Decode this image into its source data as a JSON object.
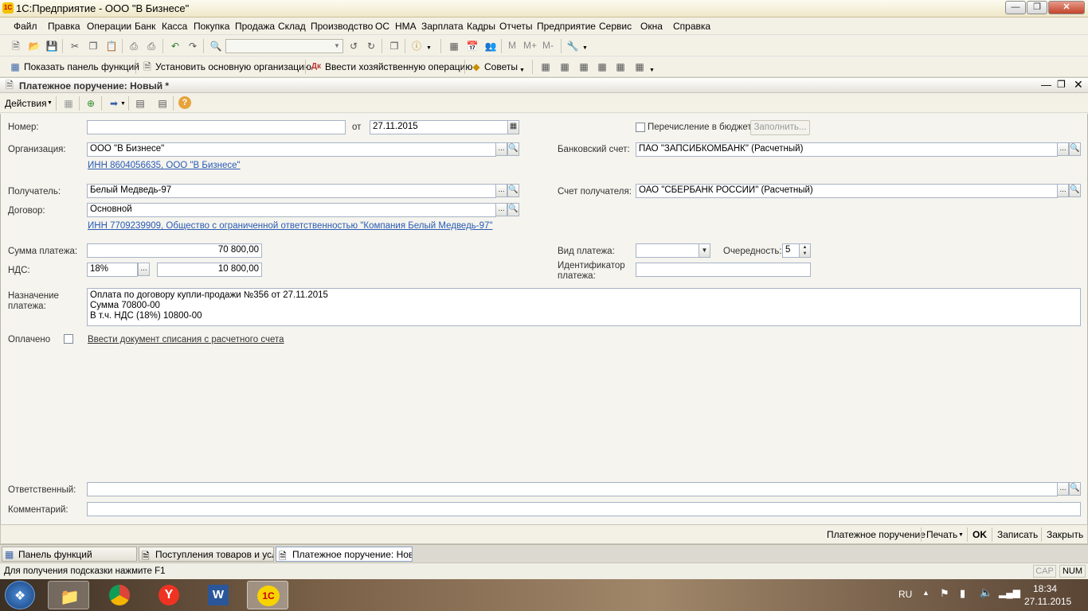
{
  "window": {
    "title": "1С:Предприятие - ООО \"В Бизнесе\""
  },
  "menu": [
    "Файл",
    "Правка",
    "Операции",
    "Банк",
    "Касса",
    "Покупка",
    "Продажа",
    "Склад",
    "Производство",
    "ОС",
    "НМА",
    "Зарплата",
    "Кадры",
    "Отчеты",
    "Предприятие",
    "Сервис",
    "Окна",
    "Справка"
  ],
  "toolbar2": {
    "show_panel": "Показать панель функций",
    "set_org": "Установить основную организацию",
    "enter_op": "Ввести хозяйственную операцию",
    "tips": "Советы",
    "m": "M",
    "m_plus": "M+",
    "m_minus": "M-"
  },
  "doc": {
    "title": "Платежное поручение: Новый *",
    "actions": "Действия",
    "fields": {
      "number_label": "Номер:",
      "number_value": "",
      "from_label": "от",
      "date": "27.11.2015",
      "budget_label": "Перечисление в бюджет",
      "fill_button": "Заполнить...",
      "org_label": "Организация:",
      "org_value": "ООО \"В Бизнесе\"",
      "org_link": "ИНН 8604056635, ООО \"В Бизнесе\"",
      "bank_label": "Банковский счет:",
      "bank_value": "ПАО \"ЗАПСИБКОМБАНК\" (Расчетный)",
      "recipient_label": "Получатель:",
      "recipient_value": "Белый Медведь-97",
      "recipient_account_label": "Счет получателя:",
      "recipient_account_value": "ОАО \"СБЕРБАНК РОССИИ\" (Расчетный)",
      "contract_label": "Договор:",
      "contract_value": "Основной",
      "contract_link": "ИНН 7709239909, Общество с ограниченной ответственностью \"Компания Белый Медведь-97\"",
      "sum_label": "Сумма платежа:",
      "sum_value": "70 800,00",
      "vat_label": "НДС:",
      "vat_rate": "18%",
      "vat_value": "10 800,00",
      "pay_type_label": "Вид платежа:",
      "pay_type_value": "",
      "order_label": "Очередность:",
      "order_value": "5",
      "pay_id_label_1": "Идентификатор",
      "pay_id_label_2": "платежа:",
      "pay_id_value": "",
      "purpose_label_1": "Назначение",
      "purpose_label_2": "платежа:",
      "purpose_lines": [
        "Оплата по договору купли-продажи №356 от 27.11.2015",
        "Сумма 70800-00",
        "В т.ч. НДС  (18%) 10800-00"
      ],
      "paid_label": "Оплачено",
      "paid_link": "Ввести документ списания с расчетного счета",
      "responsible_label": "Ответственный:",
      "responsible_value": "",
      "comment_label": "Комментарий:",
      "comment_value": ""
    },
    "footer": {
      "print_form": "Платежное поручение",
      "print": "Печать",
      "ok": "OK",
      "save": "Записать",
      "close": "Закрыть"
    }
  },
  "tabs": [
    "Панель функций",
    "Поступления товаров и услуг",
    "Платежное поручение: Нов..."
  ],
  "status": {
    "hint": "Для получения подсказки нажмите F1",
    "cap": "CAP",
    "num": "NUM"
  },
  "taskbar": {
    "lang": "RU",
    "time": "18:34",
    "date": "27.11.2015"
  }
}
